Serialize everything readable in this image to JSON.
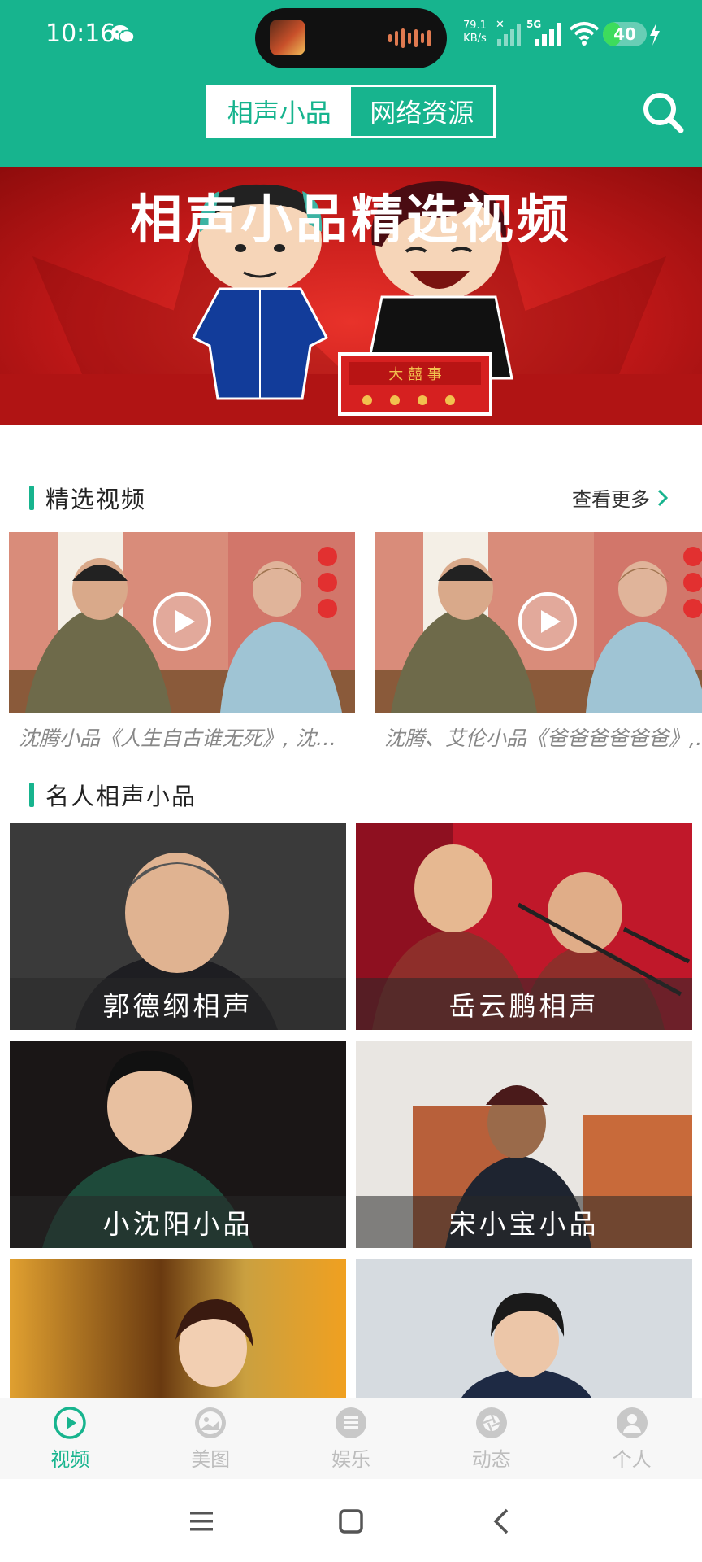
{
  "status_bar": {
    "time": "10:16",
    "net_speed_value": "79.1",
    "net_speed_unit": "KB/s",
    "network": "5G",
    "battery_level": "40",
    "battery_fraction": 0.4
  },
  "header": {
    "tabs": [
      {
        "label": "相声小品",
        "active": true
      },
      {
        "label": "网络资源",
        "active": false
      }
    ]
  },
  "banner": {
    "title": "相声小品精选视频",
    "sign_text": "大 囍 事"
  },
  "featured": {
    "title": "精选视频",
    "more_label": "查看更多",
    "videos": [
      {
        "caption": "沈腾小品《人生自古谁无死》, 沈腾…"
      },
      {
        "caption": "沈腾、艾伦小品《爸爸爸爸爸爸》, …"
      }
    ]
  },
  "celebrities": {
    "title": "名人相声小品",
    "items": [
      {
        "label": "郭德纲相声"
      },
      {
        "label": "岳云鹏相声"
      },
      {
        "label": "小沈阳小品"
      },
      {
        "label": "宋小宝小品"
      },
      {
        "label": ""
      },
      {
        "label": ""
      }
    ]
  },
  "bottom_nav": {
    "items": [
      {
        "label": "视频",
        "icon": "play-icon",
        "active": true
      },
      {
        "label": "美图",
        "icon": "image-icon",
        "active": false
      },
      {
        "label": "娱乐",
        "icon": "list-icon",
        "active": false
      },
      {
        "label": "动态",
        "icon": "aperture-icon",
        "active": false
      },
      {
        "label": "个人",
        "icon": "person-icon",
        "active": false
      }
    ]
  },
  "colors": {
    "accent": "#17b48e",
    "banner_red": "#c01818",
    "inactive_nav": "#bdbdbd"
  }
}
